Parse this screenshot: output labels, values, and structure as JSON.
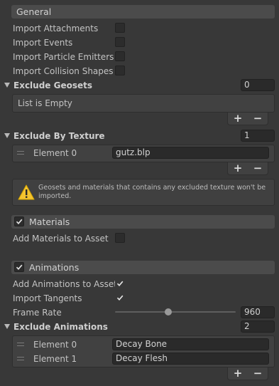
{
  "general": {
    "title": "General",
    "import_attachments": "Import Attachments",
    "import_events": "Import Events",
    "import_particle_emitters": "Import Particle Emitters",
    "import_collision_shapes": "Import Collision Shapes"
  },
  "exclude_geosets": {
    "title": "Exclude Geosets",
    "count": "0",
    "empty_text": "List is Empty"
  },
  "exclude_by_texture": {
    "title": "Exclude By Texture",
    "count": "1",
    "elements": [
      {
        "label": "Element 0",
        "value": "gutz.blp"
      }
    ]
  },
  "warning": {
    "text": "Geosets and materials that contains any excluded texture won't be imported."
  },
  "materials": {
    "title": "Materials",
    "add_materials": "Add Materials to Asset"
  },
  "animations": {
    "title": "Animations",
    "add_animations": "Add Animations to Asset",
    "import_tangents": "Import Tangents",
    "frame_rate_label": "Frame Rate",
    "frame_rate_value": "960",
    "frame_rate_fraction": 0.44
  },
  "exclude_animations": {
    "title": "Exclude Animations",
    "count": "2",
    "elements": [
      {
        "label": "Element 0",
        "value": "Decay Bone"
      },
      {
        "label": "Element 1",
        "value": "Decay Flesh"
      }
    ]
  },
  "list_controls": {
    "plus": "+",
    "minus": "−"
  }
}
